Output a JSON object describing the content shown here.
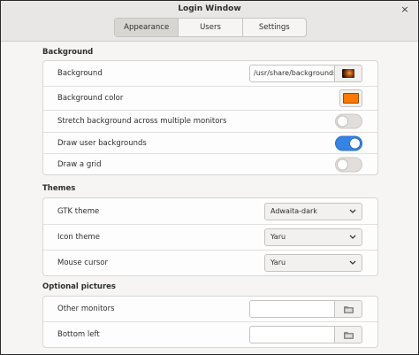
{
  "window": {
    "title": "Login Window",
    "close_glyph": "×"
  },
  "tabs": [
    {
      "label": "Appearance",
      "active": true
    },
    {
      "label": "Users",
      "active": false
    },
    {
      "label": "Settings",
      "active": false
    }
  ],
  "background_section": {
    "title": "Background",
    "rows": {
      "background": {
        "label": "Background",
        "path": "/usr/share/backgrounds/warty-final-ubuntu.png",
        "icon": "image-thumbnail-icon"
      },
      "background_color": {
        "label": "Background color",
        "color": "#ff7800"
      },
      "stretch": {
        "label": "Stretch background across multiple monitors",
        "on": false
      },
      "user_backgrounds": {
        "label": "Draw user backgrounds",
        "on": true
      },
      "grid": {
        "label": "Draw a grid",
        "on": false
      }
    }
  },
  "themes_section": {
    "title": "Themes",
    "rows": {
      "gtk": {
        "label": "GTK theme",
        "value": "Adwaita-dark"
      },
      "icon": {
        "label": "Icon theme",
        "value": "Yaru"
      },
      "cursor": {
        "label": "Mouse cursor",
        "value": "Yaru"
      }
    }
  },
  "pictures_section": {
    "title": "Optional pictures",
    "rows": {
      "other_monitors": {
        "label": "Other monitors",
        "value": "",
        "icon": "folder-icon"
      },
      "bottom_left": {
        "label": "Bottom left",
        "value": "",
        "icon": "folder-icon"
      }
    }
  },
  "colors": {
    "accent": "#3584e4",
    "swatch": "#ff7800"
  }
}
